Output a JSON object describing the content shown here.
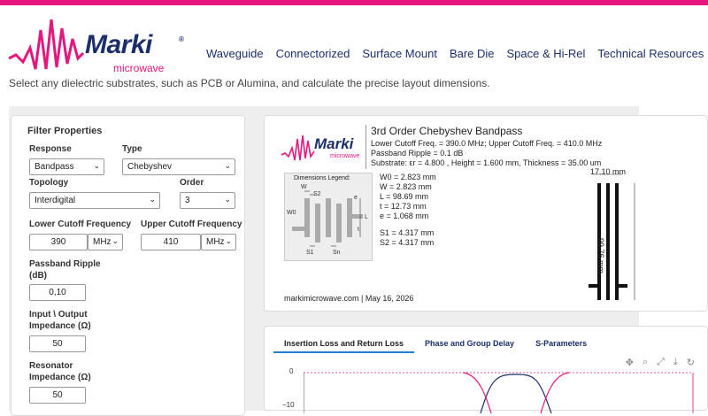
{
  "brand": {
    "name": "Marki",
    "sub": "microwave",
    "reg": "®"
  },
  "nav": [
    "Waveguide",
    "Connectorized",
    "Surface Mount",
    "Bare Die",
    "Space & Hi-Rel",
    "Technical Resources"
  ],
  "intro": {
    "line2": "Select any dielectric substrates, such as PCB or Alumina, and calculate the precise layout dimensions."
  },
  "filter": {
    "title": "Filter Properties",
    "response_label": "Response",
    "response_value": "Bandpass",
    "type_label": "Type",
    "type_value": "Chebyshev",
    "topology_label": "Topology",
    "topology_value": "Interdigital",
    "order_label": "Order",
    "order_value": "3",
    "lower_label": "Lower Cutoff Frequency",
    "lower_value": "390",
    "lower_unit": "MHz",
    "upper_label": "Upper Cutoff Frequency",
    "upper_value": "410",
    "upper_unit": "MHz",
    "ripple_label1": "Passband Ripple",
    "ripple_label2": "(dB)",
    "ripple_value": "0,10",
    "io_label1": "Input \\ Output",
    "io_label2": "Impedance (Ω)",
    "io_value": "50",
    "res_label1": "Resonator",
    "res_label2": "Impedance (Ω)",
    "res_value": "50"
  },
  "diagram": {
    "title": "3rd Order Chebyshev Bandpass",
    "line1": "Lower Cutoff Freq. = 390.0 MHz; Upper Cutoff Freq. = 410.0 MHz",
    "line2": "Passband Ripple = 0.1 dB",
    "line3": "Substrate: εr = 4.800 , Height = 1.600 mm, Thickness = 35.00 um",
    "legend_title": "Dimensions Legend:",
    "dims": [
      "W0 = 2.823 mm",
      "W = 2.823 mm",
      "L = 98.69 mm",
      "t = 12.73 mm",
      "e = 1.068 mm"
    ],
    "spacing": [
      "S1 = 4.317 mm",
      "S2 = 4.317 mm"
    ],
    "width_dim": "17.10 mm",
    "height_dim": "99.76 mm",
    "footer": "markimicrowave.com | May 16, 2026",
    "legend_labels": {
      "W": "W",
      "S2": "S2",
      "W0": "W0",
      "e": "e",
      "L": "L",
      "t": "t",
      "S1": "S1",
      "Sn": "Sn"
    }
  },
  "chart": {
    "tabs": [
      "Insertion Loss and Return Loss",
      "Phase and Group Delay",
      "S-Parameters"
    ],
    "ticks": [
      "0",
      "−10"
    ],
    "colors": {
      "il": "#1c2f6b",
      "rl": "#e5177e"
    }
  }
}
